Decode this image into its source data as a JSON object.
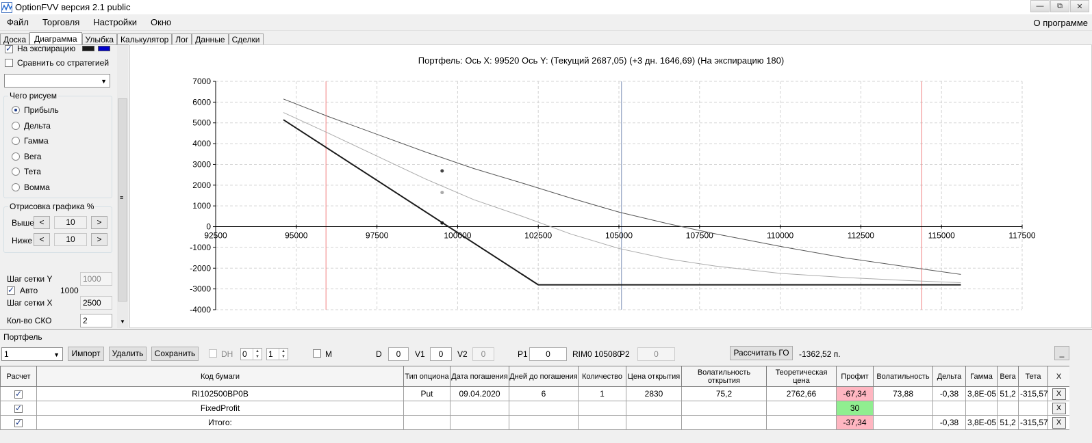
{
  "window": {
    "title": "OptionFVV версия 2.1 public",
    "btn_minimize": "—",
    "btn_restore": "⧉",
    "btn_close": "✕"
  },
  "menu": {
    "items": [
      "Файл",
      "Торговля",
      "Настройки",
      "Окно"
    ],
    "about": "О программе"
  },
  "tabs": [
    "Доска",
    "Диаграмма",
    "Улыбка",
    "Калькулятор",
    "Лог",
    "Данные",
    "Сделки"
  ],
  "active_tab": "Диаграмма",
  "left": {
    "expiry_label": "На экспирацию",
    "expiry_color1": "#1a1a1a",
    "expiry_color2": "#0000cc",
    "compare_label": "Сравнить со стратегией",
    "what_title": "Чего рисуем",
    "radios": [
      "Прибыль",
      "Дельта",
      "Гамма",
      "Вега",
      "Тета",
      "Вомма"
    ],
    "selected_radio": "Прибыль",
    "draw_title": "Отрисовка графика %",
    "above_label": "Выше",
    "above_value": "10",
    "below_label": "Ниже",
    "below_value": "10",
    "btn_left": "<",
    "btn_right": ">",
    "grid_y_label": "Шаг сетки Y",
    "grid_y_value": "1000",
    "auto_label": "Авто",
    "auto_value": "1000",
    "grid_x_label": "Шаг сетки X",
    "grid_x_value": "2500",
    "sko_label": "Кол-во СКО",
    "sko_value": "2"
  },
  "chart_header": {
    "portfolio": "Портфель:",
    "axis_x": "Ось X: 99520",
    "axis_y": "Ось Y:",
    "current": "(Текущий 2687,05)",
    "plus3": "(+3 дн. 1646,69)",
    "expiry": "(На экспирацию 180)"
  },
  "chart_data": {
    "type": "line",
    "xlim": [
      92500,
      117500
    ],
    "ylim": [
      -4000,
      7000
    ],
    "x_ticks": [
      "92500",
      "95000",
      "97500",
      "100000",
      "102500",
      "105000",
      "107500",
      "110000",
      "112500",
      "115000",
      "117500"
    ],
    "y_ticks": [
      "7000",
      "6000",
      "5000",
      "4000",
      "3000",
      "2000",
      "1000",
      "0",
      "-1000",
      "-2000",
      "-3000",
      "-4000"
    ],
    "grid": true,
    "vlines": [
      {
        "x": 95920,
        "color": "#f08080"
      },
      {
        "x": 105080,
        "color": "#7a8fb4"
      },
      {
        "x": 114380,
        "color": "#f08080"
      }
    ],
    "series": [
      {
        "color": "#1a1a1a",
        "width": 2,
        "x": [
          94600,
          102500,
          115600
        ],
        "y": [
          5150,
          -2800,
          -2800
        ]
      },
      {
        "color": "#555555",
        "width": 1,
        "x": [
          94600,
          96000,
          97500,
          99000,
          100500,
          102000,
          103500,
          105000,
          106500,
          108000,
          110000,
          112000,
          114000,
          115600
        ],
        "y": [
          6150,
          5300,
          4450,
          3600,
          2800,
          2100,
          1380,
          700,
          150,
          -350,
          -950,
          -1500,
          -1950,
          -2300
        ]
      },
      {
        "color": "#aaaaaa",
        "width": 1,
        "x": [
          94600,
          96000,
          97500,
          99000,
          100500,
          102000,
          103500,
          105000,
          106500,
          108000,
          110000,
          112000,
          114000,
          115600
        ],
        "y": [
          5500,
          4500,
          3400,
          2300,
          1300,
          500,
          -350,
          -1050,
          -1550,
          -1900,
          -2250,
          -2450,
          -2600,
          -2700
        ]
      }
    ],
    "markers": [
      {
        "x": 99520,
        "y": 2687,
        "color": "#444444"
      },
      {
        "x": 99520,
        "y": 1646,
        "color": "#aaaaaa"
      },
      {
        "x": 99520,
        "y": 180,
        "color": "#1a1a1a"
      }
    ]
  },
  "portfolio": {
    "label": "Портфель",
    "selector": "1",
    "btn_import": "Импорт",
    "btn_delete": "Удалить",
    "btn_save": "Сохранить",
    "dh_label": "DH",
    "dh_spin1": "0",
    "dh_spin2": "1",
    "m_label": "M",
    "d_label": "D",
    "d_value": "0",
    "v1_label": "V1",
    "v1_value": "0",
    "v2_label": "V2",
    "v2_value": "0",
    "p1_label": "P1",
    "p1_value": "0",
    "rim_label": "RIM0 105080",
    "p2_label": "P2",
    "p2_value": "0",
    "btn_go": "Рассчитать ГО",
    "go_value": "-1362,52 п.",
    "btn_collapse": "_"
  },
  "table": {
    "headers": [
      "Расчет",
      "Код бумаги",
      "Тип опциона",
      "Дата погашения",
      "Дней до погашения",
      "Количество",
      "Цена открытия",
      "Волатильность открытия",
      "Теоретическая цена",
      "Профит",
      "Волатильность",
      "Дельта",
      "Гамма",
      "Вега",
      "Тета",
      "X"
    ],
    "rows": [
      [
        "",
        "RI102500BP0B",
        "Put",
        "09.04.2020",
        "6",
        "1",
        "2830",
        "75,2",
        "2762,66",
        "-67,34",
        "73,88",
        "-0,38",
        "3,8E-05",
        "51,2",
        "-315,57",
        "X"
      ],
      [
        "",
        "FixedProfit",
        "",
        "",
        "",
        "",
        "",
        "",
        "",
        "30",
        "",
        "",
        "",
        "",
        "",
        "X"
      ],
      [
        "",
        "Итого:",
        "",
        "",
        "",
        "",
        "",
        "",
        "",
        "-37,34",
        "",
        "-0,38",
        "3,8E-05",
        "51,2",
        "-315,57",
        "X"
      ]
    ],
    "profit_colors": [
      "#ffb6c1",
      "#90ee90",
      "#ffb6c1"
    ]
  }
}
